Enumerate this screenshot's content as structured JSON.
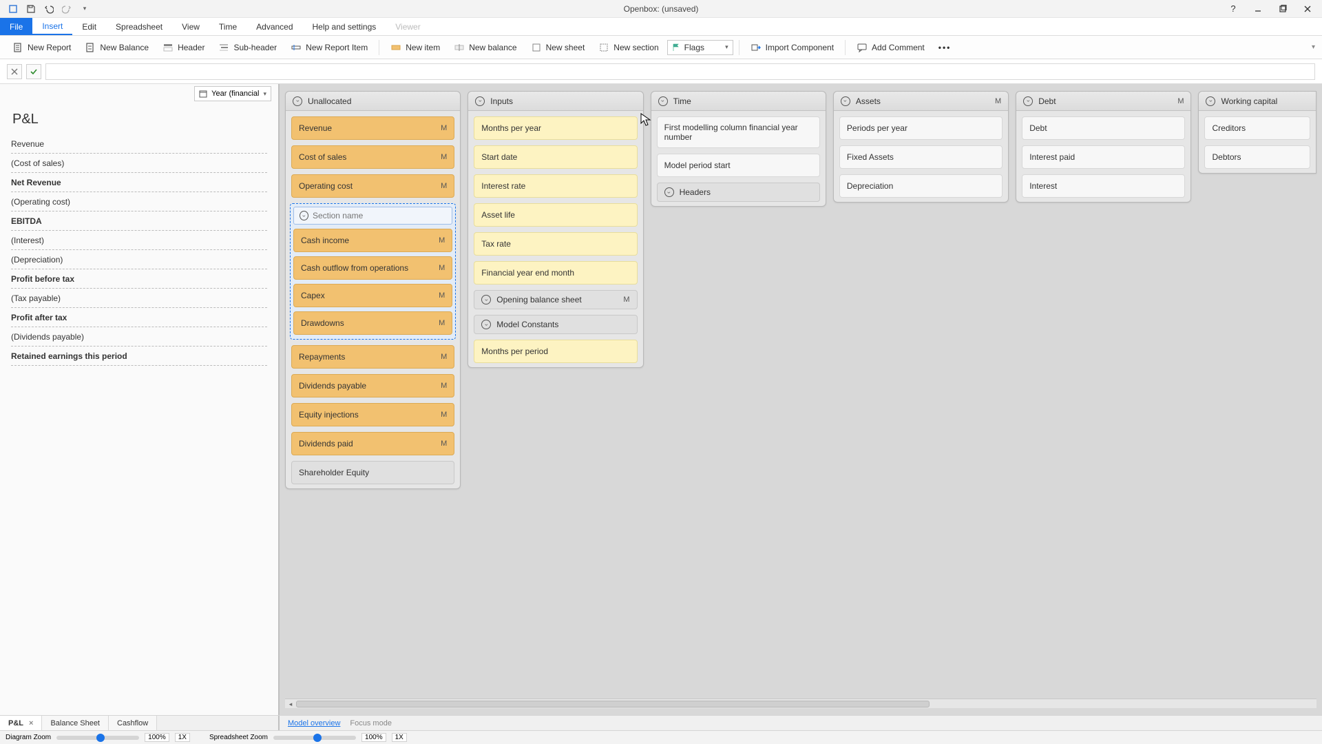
{
  "window": {
    "title": "Openbox: (unsaved)"
  },
  "menu": {
    "file": "File",
    "insert": "Insert",
    "edit": "Edit",
    "spreadsheet": "Spreadsheet",
    "view": "View",
    "time": "Time",
    "advanced": "Advanced",
    "help": "Help and settings",
    "viewer": "Viewer"
  },
  "toolbar": {
    "new_report": "New Report",
    "new_balance_report": "New Balance",
    "header": "Header",
    "sub_header": "Sub-header",
    "new_report_item": "New Report Item",
    "new_item": "New item",
    "new_balance": "New balance",
    "new_sheet": "New sheet",
    "new_section": "New section",
    "flags": "Flags",
    "import_component": "Import Component",
    "add_comment": "Add Comment"
  },
  "year_selector": "Year (financial",
  "left": {
    "title": "P&L",
    "rows": [
      {
        "label": "Revenue",
        "bold": false
      },
      {
        "label": "(Cost of sales)",
        "bold": false
      },
      {
        "label": "Net Revenue",
        "bold": true
      },
      {
        "label": "(Operating cost)",
        "bold": false
      },
      {
        "label": "EBITDA",
        "bold": true
      },
      {
        "label": "(Interest)",
        "bold": false
      },
      {
        "label": "(Depreciation)",
        "bold": false
      },
      {
        "label": "Profit before tax",
        "bold": true
      },
      {
        "label": "(Tax payable)",
        "bold": false
      },
      {
        "label": "Profit after tax",
        "bold": true
      },
      {
        "label": "(Dividends payable)",
        "bold": false
      },
      {
        "label": "Retained earnings this period",
        "bold": true
      }
    ]
  },
  "columns": {
    "unallocated": {
      "title": "Unallocated",
      "top": [
        {
          "label": "Revenue",
          "m": "M"
        },
        {
          "label": "Cost of sales",
          "m": "M"
        },
        {
          "label": "Operating cost",
          "m": "M"
        }
      ],
      "section_name_placeholder": "Section name",
      "section_items": [
        {
          "label": "Cash income",
          "m": "M"
        },
        {
          "label": "Cash outflow from operations",
          "m": "M"
        },
        {
          "label": "Capex",
          "m": "M"
        },
        {
          "label": "Drawdowns",
          "m": "M"
        }
      ],
      "rest": [
        {
          "label": "Repayments",
          "m": "M"
        },
        {
          "label": "Dividends payable",
          "m": "M"
        },
        {
          "label": "Equity injections",
          "m": "M"
        },
        {
          "label": "Dividends paid",
          "m": "M"
        }
      ],
      "footer": {
        "label": "Shareholder Equity"
      }
    },
    "inputs": {
      "title": "Inputs",
      "items": [
        "Months per year",
        "Start date",
        "Interest rate",
        "Asset life",
        "Tax rate",
        "Financial year end month"
      ],
      "opening_balance": {
        "label": "Opening balance sheet",
        "m": "M"
      },
      "model_constants": "Model Constants",
      "months_per_period": "Months per period"
    },
    "time": {
      "title": "Time",
      "items": [
        "First modelling column financial year number",
        "Model period start"
      ],
      "headers": "Headers"
    },
    "assets": {
      "title": "Assets",
      "m": "M",
      "items": [
        "Periods per year",
        "Fixed Assets",
        "Depreciation"
      ]
    },
    "debt": {
      "title": "Debt",
      "m": "M",
      "items": [
        "Debt",
        "Interest paid",
        "Interest"
      ]
    },
    "working_capital": {
      "title": "Working capital",
      "items": [
        "Creditors",
        "Debtors"
      ]
    }
  },
  "page_tabs": {
    "pl": "P&L",
    "balance": "Balance Sheet",
    "cashflow": "Cashflow"
  },
  "view_modes": {
    "model_overview": "Model overview",
    "focus_mode": "Focus mode"
  },
  "status": {
    "diagram_zoom_label": "Diagram Zoom",
    "spreadsheet_zoom_label": "Spreadsheet Zoom",
    "zoom_value": "100%",
    "zoom_1x": "1X"
  }
}
